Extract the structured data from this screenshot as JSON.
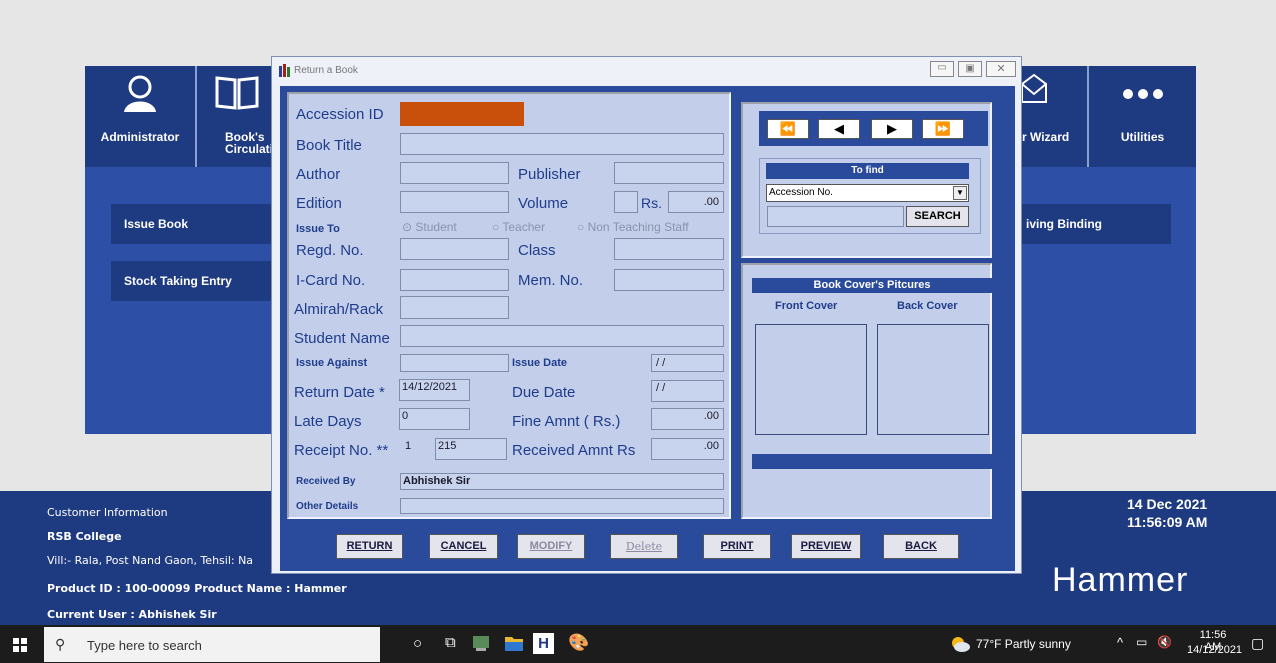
{
  "app": {
    "toolbar": [
      {
        "label": "Administrator",
        "icon": "user-icon"
      },
      {
        "label": "Book's\nCirculatio",
        "icon": "book-icon"
      },
      {
        "label": "r Wizard",
        "icon": "mail-icon"
      },
      {
        "label": "Utilities",
        "icon": "more-icon"
      }
    ],
    "menu": {
      "issue_book": "Issue Book",
      "stock_taking": "Stock Taking Entry",
      "receiving_binding": "iving Binding"
    },
    "footer": {
      "customer_info": "Customer Information",
      "college": "RSB College",
      "address": "Vill:- Rala, Post Nand Gaon, Tehsil: Na",
      "product": "Product ID : 100-00099  Product Name : Hammer",
      "current_user": "Current User : Abhishek Sir",
      "date": "14 Dec 2021",
      "time": "11:56:09 AM",
      "brand": "Hammer"
    }
  },
  "dialog": {
    "title": "Return a Book",
    "labels": {
      "accession_id": "Accession ID",
      "book_title": "Book Title",
      "author": "Author",
      "publisher": "Publisher",
      "edition": "Edition",
      "volume": "Volume",
      "rs": "Rs.",
      "issue_to": "Issue To",
      "regd_no": "Regd. No.",
      "class": "Class",
      "icard_no": "I-Card No.",
      "mem_no": "Mem. No.",
      "almirah": "Almirah/Rack",
      "student_name": "Student Name",
      "issue_against": "Issue Against",
      "issue_date": "Issue Date",
      "return_date": "Return Date *",
      "due_date": "Due Date",
      "late_days": "Late Days",
      "fine_amnt": "Fine Amnt ( Rs.)",
      "receipt_no": "Receipt No. **",
      "received_amnt": "Received Amnt Rs",
      "received_by": "Received By",
      "other_details": "Other Details"
    },
    "radios": {
      "student": "Student",
      "teacher": "Teacher",
      "non_teaching": "Non Teaching Staff"
    },
    "values": {
      "rs_value": ".00",
      "issue_date": "/ /",
      "return_date": "14/12/2021",
      "due_date": "/ /",
      "late_days": "0",
      "fine_amnt": ".00",
      "receipt_prefix": "1",
      "receipt_no": "215",
      "received_amnt": ".00",
      "received_by": "Abhishek Sir"
    },
    "find": {
      "header": "To find",
      "select_value": "Accession No.",
      "search_label": "SEARCH"
    },
    "covers": {
      "header": "Book Cover's Pitcures",
      "front": "Front Cover",
      "back": "Back Cover"
    },
    "buttons": {
      "return": "RETURN",
      "cancel": "CANCEL",
      "modify": "MODIFY",
      "delete": "Delete",
      "print": "PRINT",
      "preview": "PREVIEW",
      "back": "BACK"
    }
  },
  "taskbar": {
    "search_placeholder": "Type here to search",
    "weather": "77°F  Partly sunny",
    "time": "11:56 AM",
    "date": "14/12/2021"
  },
  "colors": {
    "accession_highlight": "#c8500a",
    "app_blue": "#1e3a80",
    "panel": "#c3cfea"
  }
}
